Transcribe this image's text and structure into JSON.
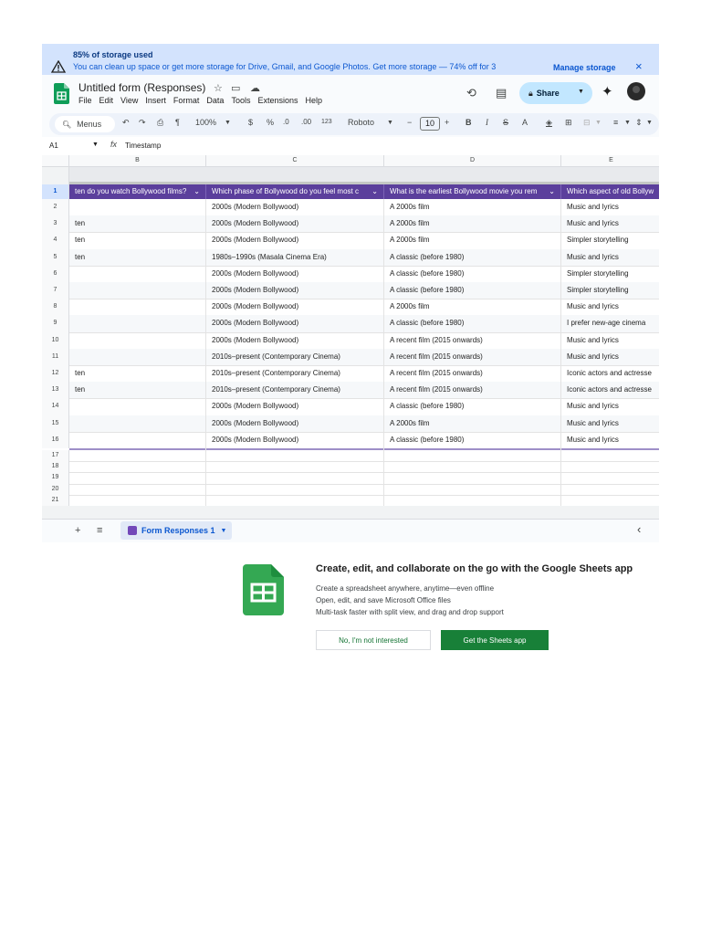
{
  "banner": {
    "storage_used": "85% of storage used",
    "message": "You can clean up space or get more storage for Drive, Gmail, and Google Photos. Get more storage — 74% off for 3",
    "manage_label": "Manage storage",
    "close_icon": "×"
  },
  "title_bar": {
    "doc_title": "Untitled form (Responses)",
    "menu": [
      "File",
      "Edit",
      "View",
      "Insert",
      "Format",
      "Data",
      "Tools",
      "Extensions",
      "Help"
    ],
    "share_label": "Share"
  },
  "toolbar": {
    "menus_label": "Menus",
    "zoom": "100%",
    "currency": "$",
    "percent": "%",
    "dec_decrease": ".0",
    "dec_increase": ".00",
    "number_format": "123",
    "font": "Roboto",
    "minus": "−",
    "font_size": "10",
    "plus": "+",
    "bold": "B",
    "italic": "I",
    "strike": "S",
    "text_color": "A"
  },
  "formula_bar": {
    "cell_ref": "A1",
    "fx": "fx",
    "formula": "Timestamp"
  },
  "grid": {
    "columns": [
      "B",
      "C",
      "D",
      "E"
    ],
    "header_row_number": "1",
    "headers": [
      "ten do you watch Bollywood films?",
      "Which phase of Bollywood do you feel most c",
      "What is the earliest Bollywood movie you rem",
      "Which aspect of old Bollyw"
    ],
    "rows": [
      {
        "n": "2",
        "b": "",
        "c": "2000s (Modern Bollywood)",
        "d": "A 2000s film",
        "e": "Music and lyrics"
      },
      {
        "n": "3",
        "b": "ten",
        "c": "2000s (Modern Bollywood)",
        "d": "A 2000s film",
        "e": "Music and lyrics"
      },
      {
        "n": "4",
        "b": "ten",
        "c": "2000s (Modern Bollywood)",
        "d": "A 2000s film",
        "e": "Simpler storytelling"
      },
      {
        "n": "5",
        "b": "ten",
        "c": "1980s–1990s (Masala Cinema Era)",
        "d": "A classic (before 1980)",
        "e": "Music and lyrics"
      },
      {
        "n": "6",
        "b": "",
        "c": "2000s (Modern Bollywood)",
        "d": "A classic (before 1980)",
        "e": "Simpler storytelling"
      },
      {
        "n": "7",
        "b": "",
        "c": "2000s (Modern Bollywood)",
        "d": "A classic (before 1980)",
        "e": "Simpler storytelling"
      },
      {
        "n": "8",
        "b": "",
        "c": "2000s (Modern Bollywood)",
        "d": "A 2000s film",
        "e": "Music and lyrics"
      },
      {
        "n": "9",
        "b": "",
        "c": "2000s (Modern Bollywood)",
        "d": "A classic (before 1980)",
        "e": "I prefer new-age cinema"
      },
      {
        "n": "10",
        "b": "",
        "c": "2000s (Modern Bollywood)",
        "d": "A recent film (2015 onwards)",
        "e": "Music and lyrics"
      },
      {
        "n": "11",
        "b": "",
        "c": "2010s–present (Contemporary Cinema)",
        "d": "A recent film (2015 onwards)",
        "e": "Music and lyrics"
      },
      {
        "n": "12",
        "b": "ten",
        "c": "2010s–present (Contemporary Cinema)",
        "d": "A recent film (2015 onwards)",
        "e": "Iconic actors and actresse"
      },
      {
        "n": "13",
        "b": "ten",
        "c": "2010s–present (Contemporary Cinema)",
        "d": "A recent film (2015 onwards)",
        "e": "Iconic actors and actresse"
      },
      {
        "n": "14",
        "b": "",
        "c": "2000s (Modern Bollywood)",
        "d": "A classic (before 1980)",
        "e": "Music and lyrics"
      },
      {
        "n": "15",
        "b": "",
        "c": "2000s (Modern Bollywood)",
        "d": "A 2000s film",
        "e": "Music and lyrics"
      },
      {
        "n": "16",
        "b": "",
        "c": "2000s (Modern Bollywood)",
        "d": "A classic (before 1980)",
        "e": "Music and lyrics"
      }
    ],
    "empty_rows": [
      "17",
      "18",
      "19",
      "20",
      "21"
    ]
  },
  "sheet_tabs": {
    "add_icon": "+",
    "list_icon": "≡",
    "active_tab": "Form Responses 1",
    "nav_prev": "‹"
  },
  "promo": {
    "title": "Create, edit, and collaborate on the go with the Google Sheets app",
    "lines": [
      "Create a spreadsheet anywhere, anytime—even offline",
      "Open, edit, and save Microsoft Office files",
      "Multi-task faster with split view, and drag and drop support"
    ],
    "decline_label": "No, I'm not interested",
    "accept_label": "Get the Sheets app"
  },
  "colors": {
    "banner_bg": "#d3e3fd",
    "header_purple": "#5b3f9c",
    "share_bg": "#c2e7ff",
    "sheets_green": "#188038"
  }
}
